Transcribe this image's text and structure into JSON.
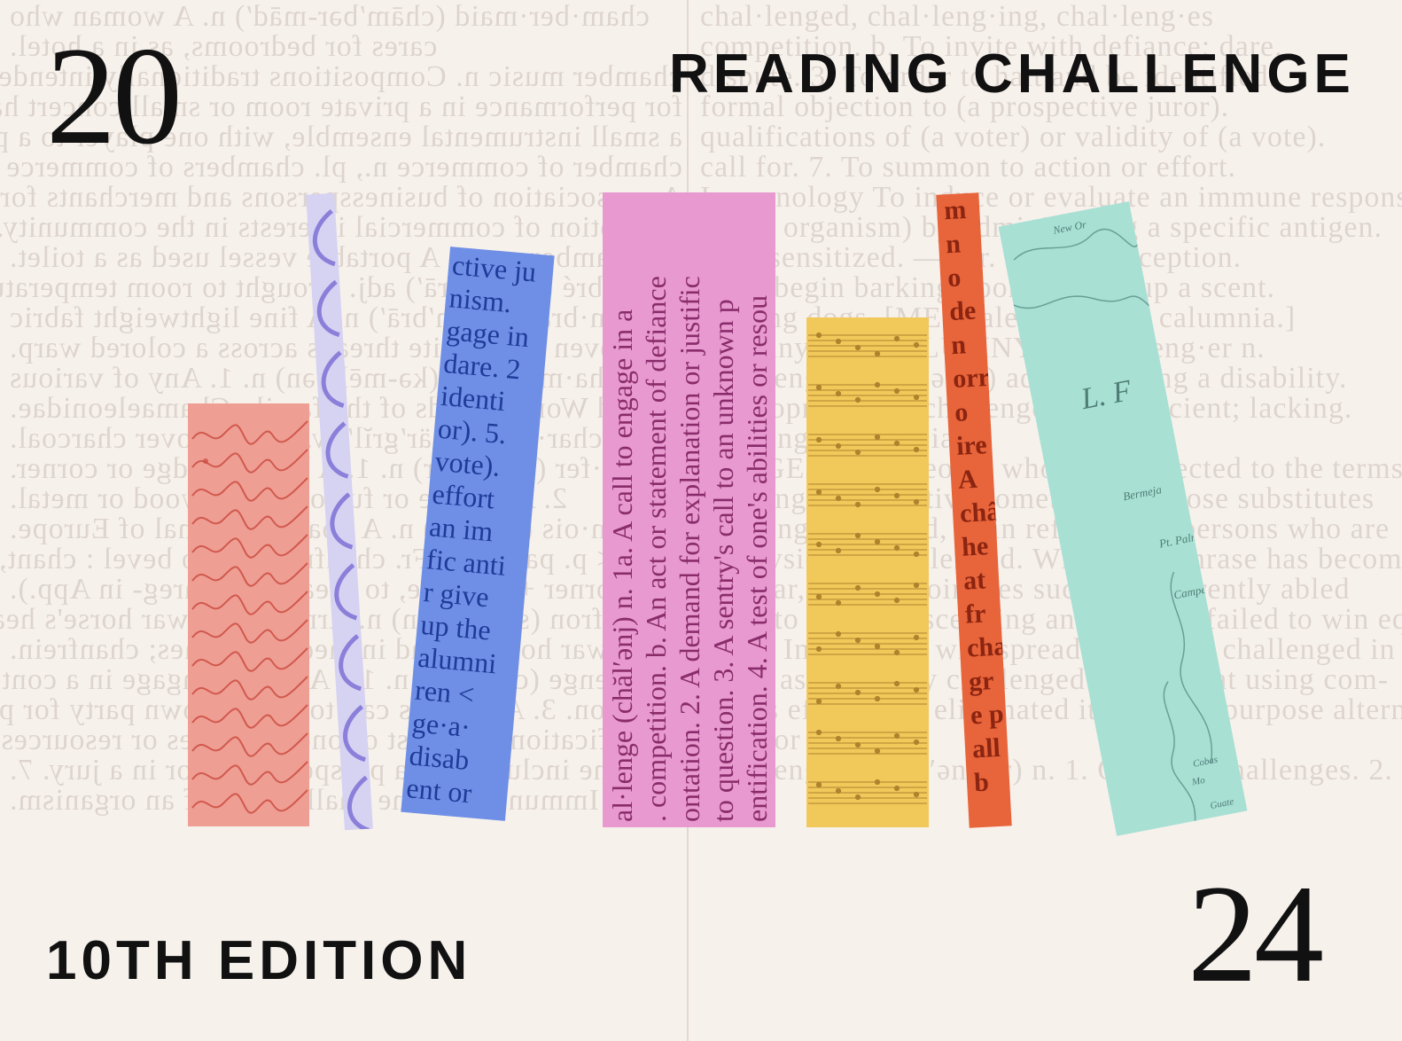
{
  "cover": {
    "year_top": "20",
    "year_bottom": "24",
    "title": "READING CHALLENGE",
    "edition": "10TH EDITION"
  },
  "colors": {
    "background": "#f7f1ec",
    "ink": "#111111",
    "coral": "#ef9e93",
    "lavender": "#d6d2f2",
    "blue": "#6f8fe6",
    "pink": "#e89ad0",
    "yellow": "#f1c85a",
    "orange": "#e8643a",
    "mint": "#a8e0d4"
  },
  "background_lines": [
    "cham·ber·maid (chām′bər-mād′) n. A woman who",
    "cares for bedrooms, as in a hotel.",
    "chamber music n. Compositions traditionally intended",
    "for performance in a private room or small concert hall by",
    "a small instrumental ensemble, with one player to a part.",
    "chamber of commerce n., pl. chambers of commerce",
    "An association of businesspersons and merchants for the",
    "promotion of commercial interests in the community.",
    "chamber pot n. A portable vessel used as a toilet.",
    "cham·bré (shäm-brā′) adj. Brought to room temperature.",
    "cham·bray (shăm′brā′) n. A fine lightweight fabric",
    "woven with white threads across a colored warp.",
    "cha·me·le·on (kə-mēl′yən) n. 1. Any of various",
    "Old World lizards of the family Chamaeleonidae.",
    "char·grill (chär′grĭl′) v. To grill over charcoal.",
    "cham·fer (chăm′fər) n. 1. A beveled edge or corner.",
    "2. A groove or furrow, as in wood or metal.",
    "cham·ois (shăm′ē) n. A goatlike animal of Europe.",
    "edge < p. part. of OFr. chanfreindre, to bevel : chant,",
    "corner + fraindre, to break (see bhreg- in App.).",
    "cham·fron (shăm′frŏn) n. Armor for a war horse's head.",
    "war horse's head in medieval times; chanfrein.",
    "chal·lenge (chăl′ənj) n. 1a. A call to engage in a contest.",
    "question. 3. A sentry's call to an unknown party for proper",
    "identification. 4. A test of one's abilities or resources.",
    "to the inclusion of a prospective juror in a jury. 7.",
    "Immunology The challenging of an organism.",
    "chal·lenged, chal·leng·ing, chal·leng·es",
    "competition. b. To invite with defiance; dare.",
    "dispute. 3. To order to halt and be identified.",
    "formal objection to (a prospective juror).",
    "qualifications of (a voter) or validity of (a vote).",
    "call for. 7. To summon to action or effort.",
    "Immunology To induce or evaluate an immune response",
    "in (an organism) by administering a specific antigen.",
    "been sensitized. —intr. To take exception.",
    "1. To begin barking upon picking up a scent.",
    "hunting dogs. [ME chalenge < Lat. calumnia.]",
    "calumny; see CALUMNY. —chal′leng·er n.",
    "chal·lenged (chăl′ənjd) adj. 1. Having a disability.",
    "developmentally challenged. 2. Deficient; lacking.",
    "challenged politicians.",
    "USAGE NOTE People who have objected to the terms",
    "as being too negative sometimes propose substitutes",
    "challenged instead, as in referring to persons who are",
    "as physically challenged. While this phrase has become",
    "popular, similar coinages such as differently abled",
    "seem to be condescending and so have failed to win equal",
    "favor. Indeed, the widespread parody of challenged in such",
    "terms as vertically challenged for inept at using com-",
    "puters effectively eliminated it as an all-purpose alternative",
    "word or phrase.",
    "chal·leng·er (chăl′ən-jər) n. 1. One that challenges. 2. Sports"
  ],
  "books": [
    {
      "name": "book-coral-handwriting",
      "text": "Lettre Chère amie je vous écris"
    },
    {
      "name": "book-lavender-pattern",
      "text": ""
    },
    {
      "name": "book-blue-dictionary",
      "lines": [
        "ctive ju",
        "nism.",
        "gage in",
        "dare. 2",
        "identi",
        "or). 5.",
        "vote).",
        "effort",
        "an im",
        "fic anti",
        "r give",
        "up the",
        "alumni",
        "ren <",
        "ge·a·",
        "disab",
        "ent or"
      ]
    },
    {
      "name": "book-pink-dictionary",
      "lines": [
        "al·lenge (chăl′ənj) n. 1a. A call to engage in a",
        ". competition. b. An act or statement of defiance",
        "ontation. 2. A demand for explanation or justific",
        "to question. 3. A sentry's call to an unknown p",
        "entification. 4. A test of one's abilities or resou"
      ]
    },
    {
      "name": "book-yellow-sheet-music",
      "text": ""
    },
    {
      "name": "book-orange-letters",
      "lines": [
        "m",
        "n",
        "o",
        "de",
        "n",
        "orr",
        "o",
        "ire",
        "A",
        "châ",
        "he",
        "at",
        "fr",
        "cha",
        "gr",
        "e p",
        "all",
        "b"
      ]
    },
    {
      "name": "book-mint-map",
      "labels": [
        "New Or",
        "L. F",
        "Bermeja",
        "Pt. Palma",
        "Campeachy",
        "Cobas",
        "Mo",
        "Guate"
      ]
    }
  ]
}
